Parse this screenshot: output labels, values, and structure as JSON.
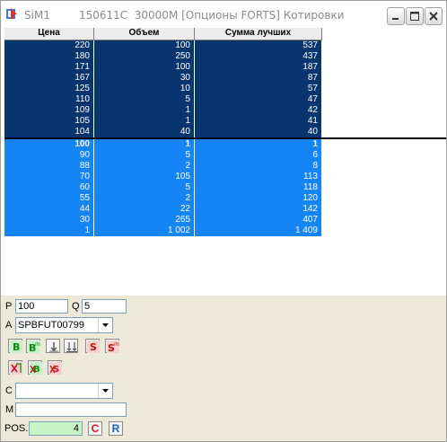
{
  "window": {
    "app": "SiM1",
    "doc_title": "150611C  30000M [Опционы FORTS] Котировки"
  },
  "columns": [
    "Цена",
    "Объем",
    "Сумма лучших"
  ],
  "asks": [
    [
      "220",
      "100",
      "537"
    ],
    [
      "180",
      "250",
      "437"
    ],
    [
      "171",
      "100",
      "187"
    ],
    [
      "167",
      "30",
      "87"
    ],
    [
      "125",
      "10",
      "57"
    ],
    [
      "110",
      "5",
      "47"
    ],
    [
      "109",
      "1",
      "42"
    ],
    [
      "105",
      "1",
      "41"
    ],
    [
      "104",
      "40",
      "40"
    ]
  ],
  "bids": [
    [
      "100",
      "1",
      "1"
    ],
    [
      "90",
      "5",
      "6"
    ],
    [
      "88",
      "2",
      "8"
    ],
    [
      "70",
      "105",
      "113"
    ],
    [
      "60",
      "5",
      "118"
    ],
    [
      "55",
      "2",
      "120"
    ],
    [
      "44",
      "22",
      "142"
    ],
    [
      "30",
      "265",
      "407"
    ],
    [
      "1",
      "1 002",
      "1 409"
    ]
  ],
  "panel": {
    "p_label": "P",
    "p_value": "100",
    "q_label": "Q",
    "q_value": "5",
    "a_label": "A",
    "a_value": "SPBFUT00799",
    "c_label": "C",
    "c_value": "",
    "m_label": "M",
    "m_value": "",
    "pos_label": "POS.",
    "pos_value": "4",
    "pos_c_label": "C",
    "pos_r_label": "R"
  },
  "colors": {
    "ask_bg": "#08356e",
    "bid_bg": "#1585f5",
    "panel_bg": "#ece9d8",
    "pos_bg": "#c8f5c8"
  },
  "icons": {
    "row1": [
      "buy-icon",
      "buy-market-icon",
      "buy-stop-icon",
      "buy-stop-multi-icon",
      "sell-icon",
      "sell-market-icon"
    ],
    "row2": [
      "cancel-all-icon",
      "cancel-buy-icon",
      "cancel-sell-icon"
    ]
  }
}
